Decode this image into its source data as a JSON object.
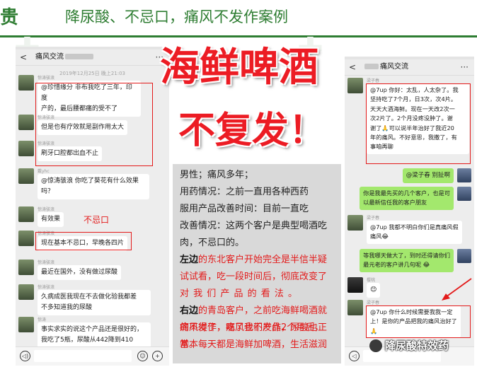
{
  "header": {
    "brand": "贵",
    "title": "降尿酸、不忌口，痛风不发作案例"
  },
  "colors": {
    "green": "#2e7d32",
    "red": "#ec1c24",
    "chat_bg": "#ededed",
    "bubble_green": "#a3e86d"
  },
  "left_chat": {
    "back": "<",
    "title": "痛风交流",
    "menu": "···",
    "time": "2019年12月25日 晚上21:03",
    "messages": [
      {
        "name": "惊涛骇浪",
        "text1": "@珍惜缘分  非布我吃了三年，印度",
        "text2": "产的，最后腰都痛的受不了"
      },
      {
        "name": "惊涛骇浪",
        "text1": "但是也有疗效就是副作用太大"
      },
      {
        "name": "惊涛骇浪",
        "text1": "刷牙口腔都出血不止"
      },
      {
        "name": "戴yhc",
        "text1": "@惊涛骇浪  你吃了葵花有什么效果",
        "text2": "吗？"
      },
      {
        "name": "惊涛骇浪",
        "text1": "有效果"
      },
      {
        "name": "惊涛骇浪",
        "text1": "现在基本不忌口，早晚各四片"
      },
      {
        "name": "惊涛骇浪",
        "text1": "最近在国外，没有做过尿酸"
      },
      {
        "name": "惊涛骇浪",
        "text1": "久病成医我现在不去做化验我都差",
        "text2": "不多知道我的尿酸"
      },
      {
        "name": "惊涛",
        "text1": "事实求实的说这个产品还是很好的，",
        "text2": "我吃了5瓶，尿酸从442降到410"
      }
    ],
    "tag": "不忌口",
    "input_voice": "◁)",
    "input_emoji": "☺",
    "input_plus": "+"
  },
  "headline": {
    "line1": "海鲜啤酒",
    "line2": "不复发！"
  },
  "summary": {
    "l1": "男性；痛风多年；",
    "l2": "用药情况：之前一直用各种西药",
    "l3": "服用产品改善时间：目前一直吃",
    "l4": "改善情况：这两个客户是典型喝酒吃",
    "l5": "肉，不忌口的。",
    "l6a": "左边",
    "l6b": "的东北客户开始完全是半信半疑",
    "l7": "试试看，吃一段时间后，彻底改变了",
    "l8": "对 我 们 产 品 的 看 法 。",
    "l9a": "右边",
    "l9b": "的青岛客户，之前吃海鲜喝酒就",
    "l10": "痛风发作，吃了我们产品2个月后，",
    "l11": "基本每天都是海鲜加啤酒，生活滋润",
    "l12": "的不得了，痛风也不发作，尿酸也正",
    "l13": "常。"
  },
  "right_chat": {
    "back": "<",
    "title": "痛风交流",
    "menu": "···",
    "m1_name": "梁子春",
    "m1_l1": "@7up  你好：太乱，人太杂了。我",
    "m1_l2": "坚持吃了7个月，日3次，次4片。",
    "m1_l3": "天天大酒海鲜。现在一天改2次一",
    "m1_l4": "次2片了。2个月没疼没肿了。谢",
    "m1_l5": "谢了🙏可以说半年治好了我近20",
    "m1_l6": "年的痛风。不好意思，我撒了，有",
    "m1_l7": "事咱再聊",
    "m2": "@梁子春  别扯啊",
    "m3_l1": "你是我最先买的几个客户，也是可",
    "m3_l2": "以最新信任我的客户朋友",
    "m4_name": "梁子春",
    "m4_l1": "@7up  我都不明白你们是真痛风假",
    "m4_l2": "痛风😂",
    "m5_l1": "等我哪天做大了，到时还得请你们",
    "m5_l2": "最元老的客户讲几句呢  😂",
    "m6_name": "樱桃",
    "m6": "😊",
    "m7_name": "梁子春",
    "m7_l1": "@7up  你什么时候需要我我一定",
    "m7_l2": "上！是你的产品把我的痛风治好了",
    "m7_l3": "🙏"
  },
  "signature": "降尿酸特效药"
}
